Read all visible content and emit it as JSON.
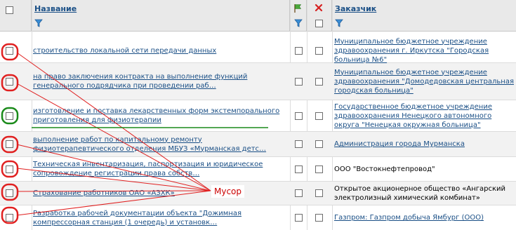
{
  "header": {
    "name_label": "Название",
    "customer_label": "Заказчик",
    "flag_icon": "green-flag-icon",
    "delete_icon": "red-x-icon",
    "filter_icon": "funnel-icon"
  },
  "rows": [
    {
      "name": "строительство локальной сети передачи данных",
      "customer": "Муниципальное бюджетное учреждение здравоохранения г. Иркутска \"Городская больница №6\"",
      "customer_link": true
    },
    {
      "name": "на право заключения контракта на выполнение функций генерального подрядчика при проведении раб…",
      "customer": "Муниципальное бюджетное учреждение здравоохранения \"Домодедовская центральная городская больница\"",
      "customer_link": true
    },
    {
      "name": "изготовление и поставка лекарственных форм экстемпорального приготовления для физиотерапии",
      "customer": "Государственное бюджетное учреждение здравоохранения Ненецкого автономного округа \"Ненецкая окружная больница\"",
      "customer_link": true
    },
    {
      "name": "выполнение работ по капитальному ремонту физиотерапевтического отделения МБУЗ «Мурманская детс…",
      "customer": "Администрация города Мурманска",
      "customer_link": true
    },
    {
      "name": "Техническая инвентаризация, паспортизация и юридическое сопровождение регистрации права собств…",
      "customer": "ООО \"Востокнефтепровод\"",
      "customer_link": false
    },
    {
      "name": "Страхование работников ОАО «АЗХК»",
      "customer": "Открытое акционерное общество «Ангарский электролизный химический комбинат»",
      "customer_link": false
    },
    {
      "name": "Разработка рабочей документации объекта \"Дожимная компрессорная станция (1 очередь) и установк…",
      "customer": "Газпром: Газпром добыча Ямбург (ООО)",
      "customer_link": true
    }
  ],
  "annotation": {
    "label": "Мусор",
    "circle_colors": [
      "#e02020",
      "#e02020",
      "#1a8a1a",
      "#e02020",
      "#e02020",
      "#e02020",
      "#e02020"
    ],
    "line_color": "#e02020",
    "underline_color": "#1a8a1a"
  }
}
